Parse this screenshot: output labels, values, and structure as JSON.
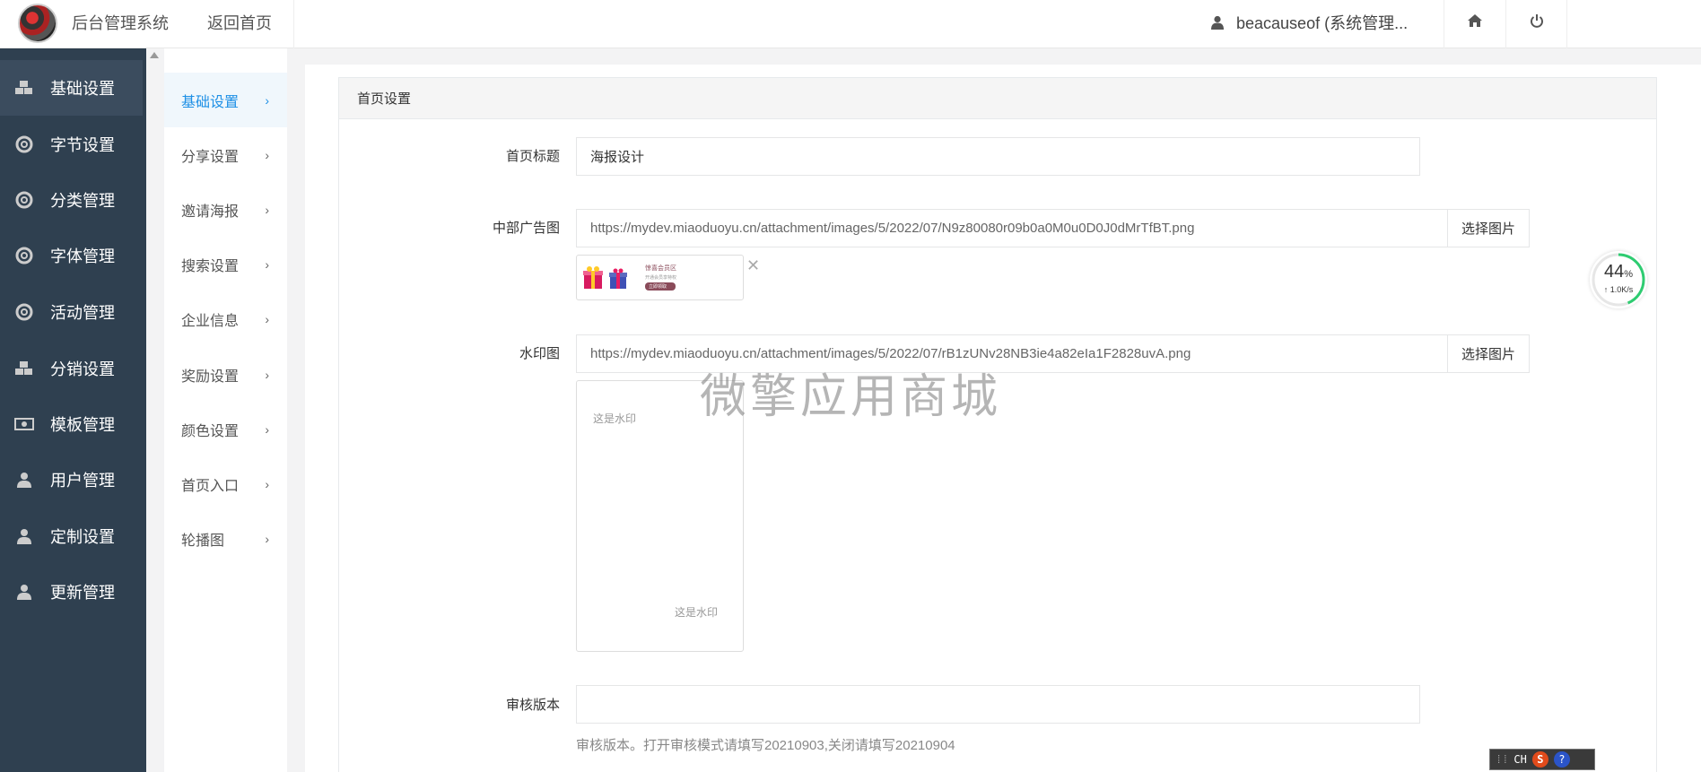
{
  "header": {
    "app_title": "后台管理系统",
    "back_home": "返回首页",
    "user": "beacauseof (系统管理..."
  },
  "sidebar": {
    "items": [
      {
        "label": "基础设置",
        "icon": "cubes-icon",
        "active": true
      },
      {
        "label": "字节设置",
        "icon": "lifebuoy-icon"
      },
      {
        "label": "分类管理",
        "icon": "lifebuoy-icon"
      },
      {
        "label": "字体管理",
        "icon": "lifebuoy-icon"
      },
      {
        "label": "活动管理",
        "icon": "lifebuoy-icon"
      },
      {
        "label": "分销设置",
        "icon": "cubes-icon"
      },
      {
        "label": "模板管理",
        "icon": "money-icon"
      },
      {
        "label": "用户管理",
        "icon": "user-icon"
      },
      {
        "label": "定制设置",
        "icon": "user-icon"
      },
      {
        "label": "更新管理",
        "icon": "user-icon"
      }
    ]
  },
  "submenu": {
    "items": [
      {
        "label": "基础设置",
        "active": true
      },
      {
        "label": "分享设置"
      },
      {
        "label": "邀请海报"
      },
      {
        "label": "搜索设置"
      },
      {
        "label": "企业信息"
      },
      {
        "label": "奖励设置"
      },
      {
        "label": "颜色设置"
      },
      {
        "label": "首页入口"
      },
      {
        "label": "轮播图"
      }
    ]
  },
  "panel": {
    "title": "首页设置",
    "home_title_label": "首页标题",
    "home_title_value": "海报设计",
    "ad_label": "中部广告图",
    "ad_url": "https://mydev.miaoduoyu.cn/attachment/images/5/2022/07/N9z80080r09b0a0M0u0D0J0dMrTfBT.png",
    "ad_banner_text": [
      "惊喜会员区",
      "开通会员享特权",
      "立即领取"
    ],
    "watermark_label": "水印图",
    "watermark_url": "https://mydev.miaoduoyu.cn/attachment/images/5/2022/07/rB1zUNv28NB3ie4a82eIa1F2828uvA.png",
    "watermark_text": "这是水印",
    "review_label": "审核版本",
    "review_value": "",
    "review_help": "审核版本。打开审核模式请填写20210903,关闭请填写20210904",
    "pick_image": "选择图片"
  },
  "overlay": {
    "big_watermark": "微擎应用商城",
    "speed_percent": "44",
    "speed_unit": "%",
    "speed_rate": "↑ 1.0K/s",
    "ime_mode": "CH"
  },
  "colors": {
    "sidebar_bg": "#2f4050",
    "accent": "#1e90e6"
  }
}
